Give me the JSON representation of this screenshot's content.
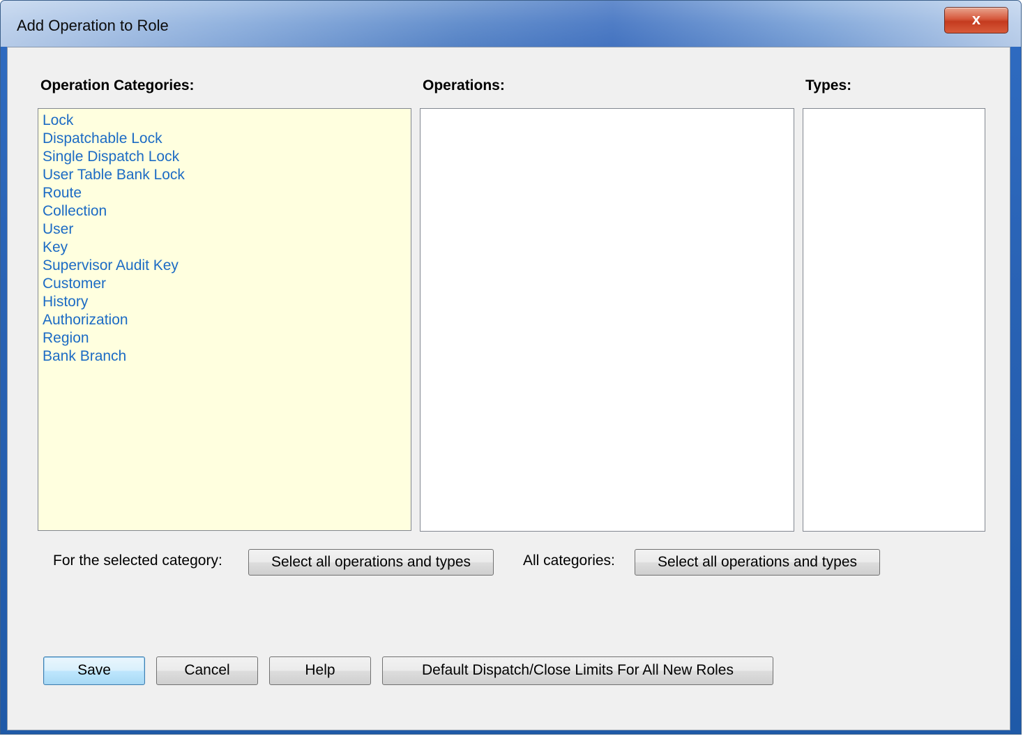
{
  "window": {
    "title": "Add Operation to Role",
    "close_glyph": "x"
  },
  "headers": {
    "categories": "Operation Categories:",
    "operations": "Operations:",
    "types": "Types:"
  },
  "categories": [
    "Lock",
    "Dispatchable Lock",
    "Single Dispatch Lock",
    "User Table Bank Lock",
    "Route",
    "Collection",
    "User",
    "Key",
    "Supervisor Audit Key",
    "Customer",
    "History",
    "Authorization",
    "Region",
    "Bank Branch"
  ],
  "operations": [],
  "types": [],
  "selection": {
    "selected_category_label": "For the selected category:",
    "selected_category_button": "Select all operations and types",
    "all_categories_label": "All categories:",
    "all_categories_button": "Select all operations and types"
  },
  "footer": {
    "save": "Save",
    "cancel": "Cancel",
    "help": "Help",
    "defaults": "Default Dispatch/Close Limits For All New Roles"
  },
  "colors": {
    "list_item_text": "#1c6bc4",
    "categories_background": "#ffffdf",
    "dialog_background": "#f0f0f0"
  }
}
